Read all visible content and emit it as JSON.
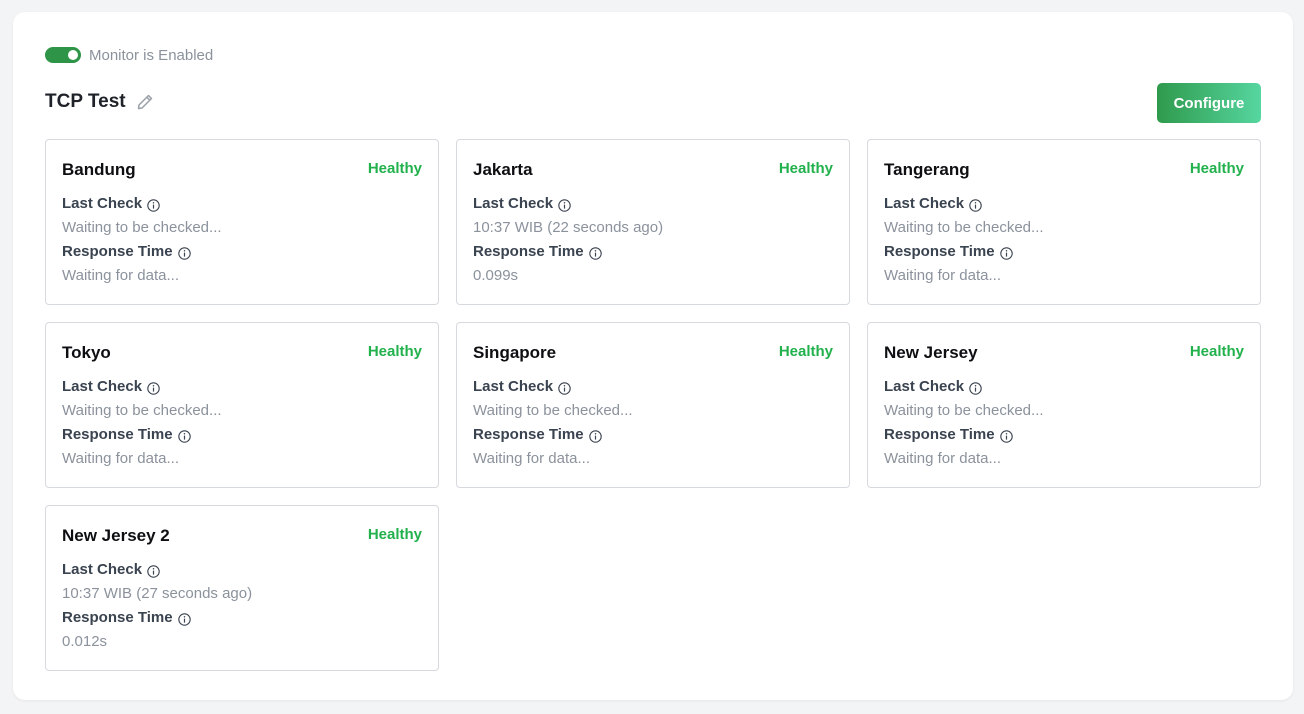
{
  "monitor": {
    "toggle_label": "Monitor is Enabled",
    "enabled": true,
    "title": "TCP Test",
    "configure_label": "Configure"
  },
  "labels": {
    "last_check": "Last Check",
    "response_time": "Response Time"
  },
  "colors": {
    "accent": "#2e9447",
    "healthy": "#22b14c"
  },
  "locations": [
    {
      "name": "Bandung",
      "status": "Healthy",
      "last_check": "Waiting to be checked...",
      "response_time": "Waiting for data..."
    },
    {
      "name": "Jakarta",
      "status": "Healthy",
      "last_check": "10:37 WIB (22 seconds ago)",
      "response_time": "0.099s"
    },
    {
      "name": "Tangerang",
      "status": "Healthy",
      "last_check": "Waiting to be checked...",
      "response_time": "Waiting for data..."
    },
    {
      "name": "Tokyo",
      "status": "Healthy",
      "last_check": "Waiting to be checked...",
      "response_time": "Waiting for data..."
    },
    {
      "name": "Singapore",
      "status": "Healthy",
      "last_check": "Waiting to be checked...",
      "response_time": "Waiting for data..."
    },
    {
      "name": "New Jersey",
      "status": "Healthy",
      "last_check": "Waiting to be checked...",
      "response_time": "Waiting for data..."
    },
    {
      "name": "New Jersey 2",
      "status": "Healthy",
      "last_check": "10:37 WIB (27 seconds ago)",
      "response_time": "0.012s"
    }
  ]
}
